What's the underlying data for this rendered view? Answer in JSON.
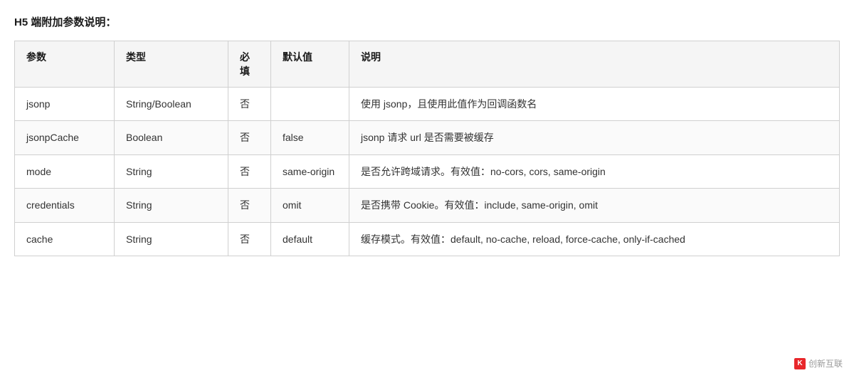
{
  "title": "H5 端附加参数说明：",
  "table": {
    "headers": {
      "param": "参数",
      "type": "类型",
      "required": "必填",
      "default": "默认值",
      "description": "说明"
    },
    "rows": [
      {
        "param": "jsonp",
        "type": "String/Boolean",
        "required": "否",
        "default": "",
        "description": "使用 jsonp，且使用此值作为回调函数名"
      },
      {
        "param": "jsonpCache",
        "type": "Boolean",
        "required": "否",
        "default": "false",
        "description": "jsonp 请求 url 是否需要被缓存"
      },
      {
        "param": "mode",
        "type": "String",
        "required": "否",
        "default": "same-origin",
        "description": "是否允许跨域请求。有效值：no-cors, cors, same-origin"
      },
      {
        "param": "credentials",
        "type": "String",
        "required": "否",
        "default": "omit",
        "description": "是否携带 Cookie。有效值：include, same-origin, omit"
      },
      {
        "param": "cache",
        "type": "String",
        "required": "否",
        "default": "default",
        "description": "缓存模式。有效值：default, no-cache, reload, force-cache, only-if-cached"
      }
    ]
  },
  "watermark": {
    "icon": "K",
    "text": "创新互联"
  }
}
